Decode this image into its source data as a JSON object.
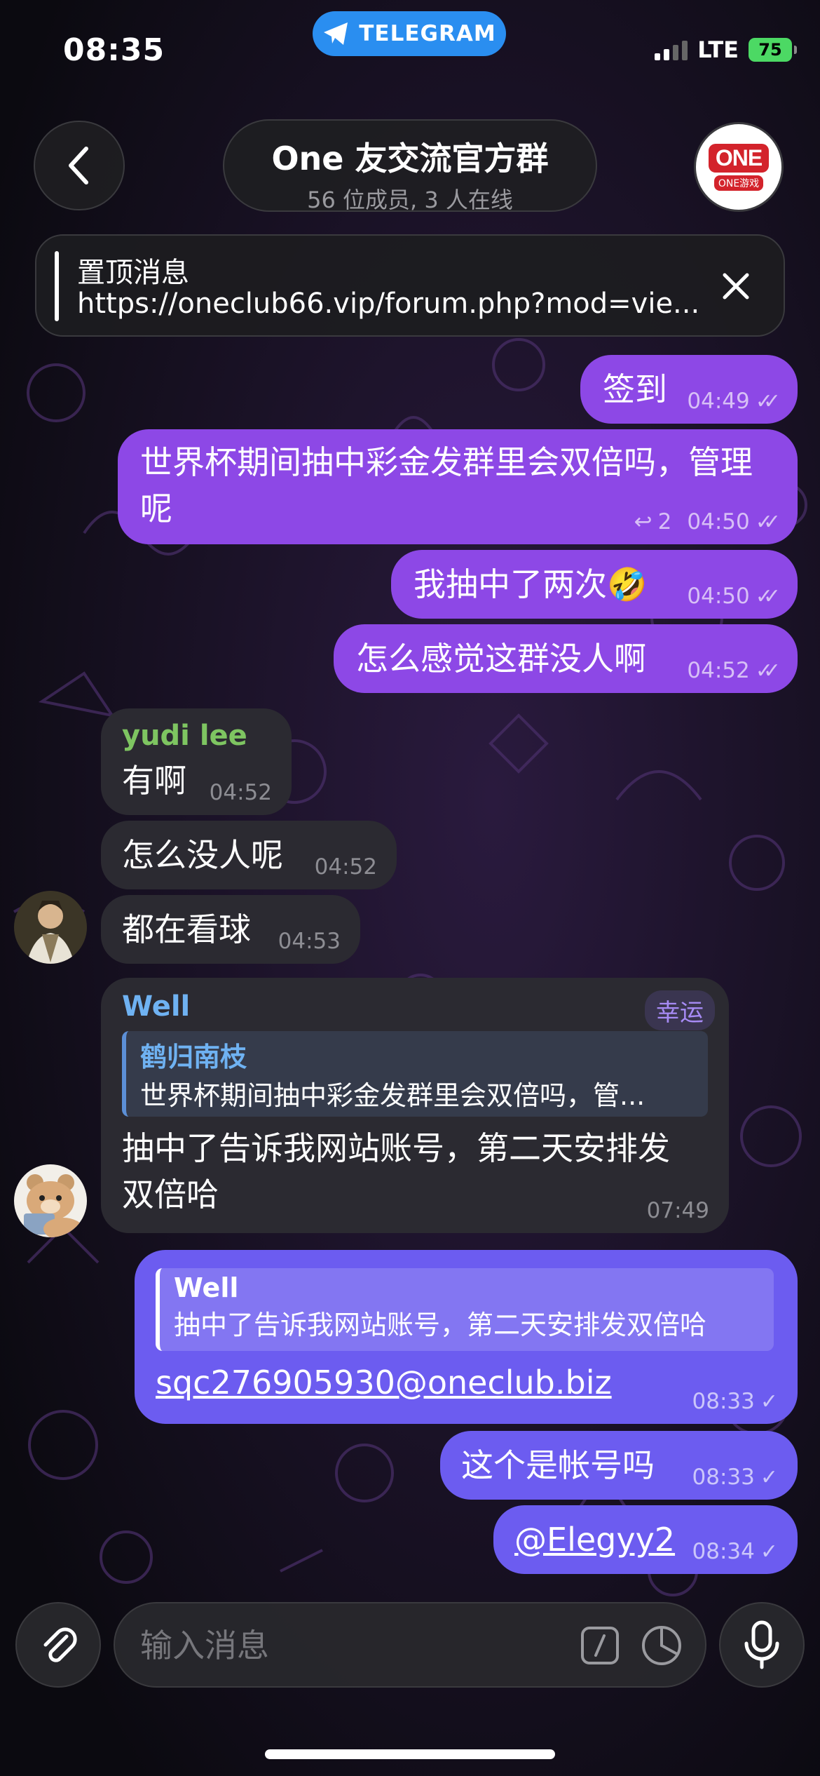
{
  "status_bar": {
    "time": "08:35",
    "app_pill": "TELEGRAM",
    "network": "LTE",
    "battery": "75"
  },
  "header": {
    "title": "One 友交流官方群",
    "subtitle": "56 位成员, 3 人在线",
    "group_logo_text": "ONE",
    "group_logo_sub": "ONE游戏"
  },
  "pinned": {
    "title": "置顶消息",
    "text": "https://oneclub66.vip/forum.php?mod=vie..."
  },
  "messages": [
    {
      "text": "签到",
      "time": "04:49"
    },
    {
      "text": "世界杯期间抽中彩金发群里会双倍吗，管理呢",
      "time": "04:50",
      "replies": "2"
    },
    {
      "text": "我抽中了两次🤣",
      "time": "04:50"
    },
    {
      "text": "怎么感觉这群没人啊",
      "time": "04:52"
    },
    {
      "sender": "yudi lee",
      "text": "有啊",
      "time": "04:52"
    },
    {
      "text": "怎么没人呢",
      "time": "04:52"
    },
    {
      "text": "都在看球",
      "time": "04:53"
    },
    {
      "sender": "Well",
      "badge": "幸运",
      "reply_name": "鹤归南枝",
      "reply_text": "世界杯期间抽中彩金发群里会双倍吗，管...",
      "text": "抽中了告诉我网站账号，第二天安排发双倍哈",
      "time": "07:49"
    },
    {
      "reply_name": "Well",
      "reply_text": "抽中了告诉我网站账号，第二天安排发双倍哈",
      "text": "sqc276905930@oneclub.biz",
      "time": "08:33"
    },
    {
      "text": "这个是帐号吗",
      "time": "08:33"
    },
    {
      "text": "@Elegyy2",
      "time": "08:34"
    }
  ],
  "composer": {
    "placeholder": "输入消息"
  },
  "colors": {
    "outgoing": "#8d48e6",
    "outgoing_reply": "#6c5cf0",
    "incoming": "#2b2a31",
    "sender_green": "#7ec561",
    "sender_blue": "#6fb2f2",
    "badge": "#a78bf5",
    "link": "#ffffff"
  },
  "icons": [
    "back-icon",
    "telegram-icon",
    "close-icon",
    "attach-icon",
    "command-icon",
    "sticker-icon",
    "mic-icon",
    "reply-arrow-icon",
    "check-icon"
  ]
}
